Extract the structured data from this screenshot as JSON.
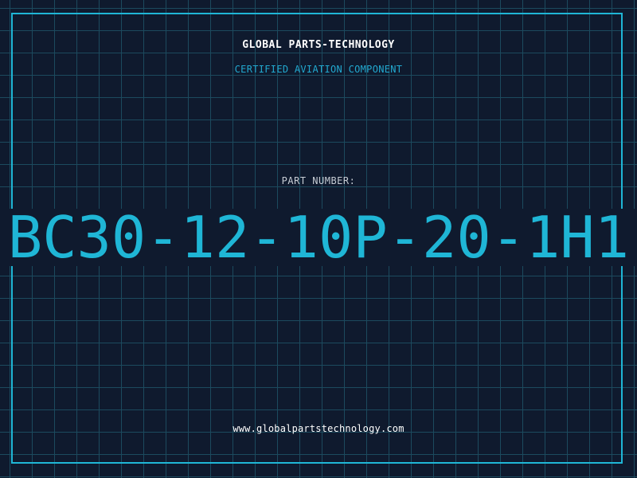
{
  "header": {
    "brand": "GLOBAL PARTS-TECHNOLOGY",
    "tagline": "CERTIFIED AVIATION COMPONENT"
  },
  "part": {
    "label": "PART NUMBER:",
    "number": "BC30-12-10P-20-1H1"
  },
  "footer": {
    "url": "www.globalpartstechnology.com"
  },
  "colors": {
    "background": "#0f1a2e",
    "grid": "#1c4a5e",
    "accent": "#1fb6d6",
    "text": "#ffffff",
    "muted": "#c6ccd4"
  }
}
